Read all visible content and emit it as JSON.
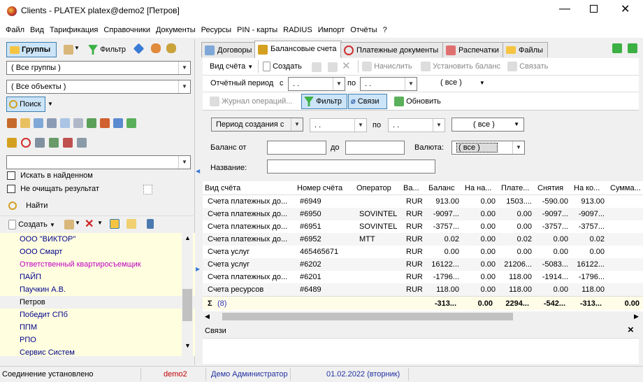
{
  "window": {
    "title": "Clients - PLATEX platex@demo2 [Петров]"
  },
  "menu": [
    "Файл",
    "Вид",
    "Тарификация",
    "Справочники",
    "Документы",
    "Ресурсы",
    "PIN - карты",
    "RADIUS",
    "Импорт",
    "Отчёты",
    "?"
  ],
  "left": {
    "groups_button": "Группы",
    "filter_button": "Фильтр",
    "all_groups": "( Все группы )",
    "all_objects": "( Все объекты )",
    "search_button": "Поиск",
    "search_in_found": "Искать в найденном",
    "no_clear_result": "Не очищать результат",
    "find_button": "Найти",
    "create_button": "Создать",
    "items": [
      "ООО \"ВИКТОР\"",
      "ООО Смарт",
      "Ответственный квартиросъемщик",
      "ПАЙП",
      "Паучкин А.В.",
      "Петров",
      "Победит СПб",
      "ППМ",
      "РПО",
      "Сервис Систем"
    ]
  },
  "tabs": [
    "Договоры",
    "Балансовые счета",
    "Платежные документы",
    "Распечатки",
    "Файлы"
  ],
  "toolbar1": {
    "view": "Вид счёта",
    "create": "Создать",
    "charge": "Начислить",
    "set_balance": "Установить баланс",
    "link": "Связать"
  },
  "period": {
    "label": "Отчётный период",
    "from": "с",
    "from_val": ". .",
    "to": "по",
    "to_val": ". .",
    "all": "( все )"
  },
  "toolbar2": {
    "journal": "Журнал операций...",
    "filter": "Фильтр",
    "links": "Связи",
    "refresh": "Обновить"
  },
  "filters": {
    "created_period": "Период создания с",
    "date1": ". .",
    "to": "по",
    "date2": ". .",
    "all": "( все )",
    "balance_from": "Баланс от",
    "balance_to": "до",
    "currency": "Валюта:",
    "currency_val": "( все )",
    "name": "Название:"
  },
  "grid": {
    "columns": [
      "Вид счёта",
      "Номер счёта",
      "Оператор",
      "Ва...",
      "Баланс",
      "На на...",
      "Плате...",
      "Снятия",
      "На ко...",
      "Сумма..."
    ],
    "rows": [
      [
        "Счета платежных до...",
        "#6949",
        "",
        "RUR",
        "913.00",
        "0.00",
        "1503....",
        "-590.00",
        "913.00",
        ""
      ],
      [
        "Счета платежных до...",
        "#6950",
        "SOVINTEL",
        "RUR",
        "-9097...",
        "0.00",
        "0.00",
        "-9097...",
        "-9097...",
        ""
      ],
      [
        "Счета платежных до...",
        "#6951",
        "SOVINTEL",
        "RUR",
        "-3757...",
        "0.00",
        "0.00",
        "-3757...",
        "-3757...",
        ""
      ],
      [
        "Счета платежных до...",
        "#6952",
        "МТТ",
        "RUR",
        "0.02",
        "0.00",
        "0.02",
        "0.00",
        "0.02",
        ""
      ],
      [
        "Счета услуг",
        "465465671",
        "",
        "RUR",
        "0.00",
        "0.00",
        "0.00",
        "0.00",
        "0.00",
        ""
      ],
      [
        "Счета услуг",
        "#6202",
        "",
        "RUR",
        "16122...",
        "0.00",
        "21206...",
        "-5083...",
        "16122...",
        ""
      ],
      [
        "Счета платежных до...",
        "#6201",
        "",
        "RUR",
        "-1796...",
        "0.00",
        "118.00",
        "-1914...",
        "-1796...",
        ""
      ],
      [
        "Счета ресурсов",
        "#6489",
        "",
        "RUR",
        "118.00",
        "0.00",
        "118.00",
        "0.00",
        "118.00",
        ""
      ]
    ],
    "total": {
      "sigma": "Σ",
      "count": "(8)",
      "values": [
        "-313...",
        "0.00",
        "2294...",
        "-542...",
        "-313...",
        "0.00"
      ]
    }
  },
  "links_panel": {
    "title": "Связи",
    "close": "×"
  },
  "status": {
    "connection": "Соединение установлено",
    "db": "demo2",
    "user": "Демо Администратор",
    "date": "01.02.2022 (вторник)"
  }
}
